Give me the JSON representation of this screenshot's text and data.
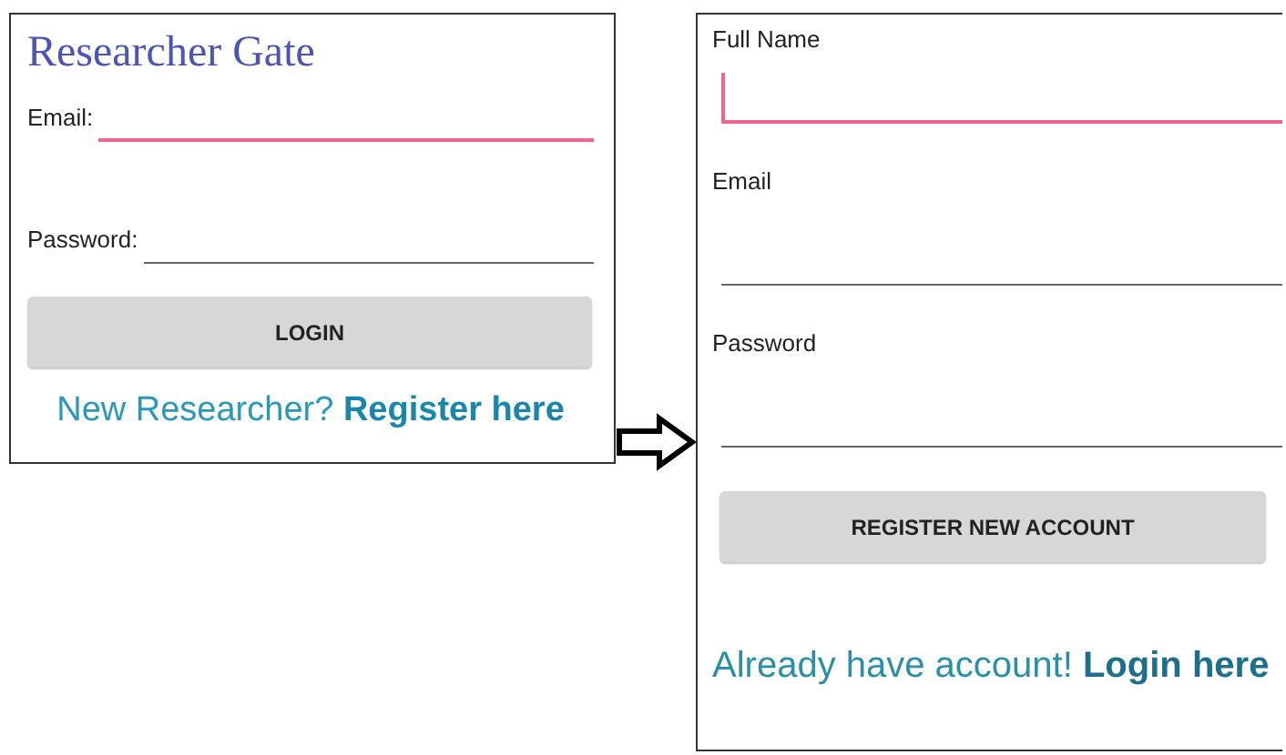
{
  "login_screen": {
    "title": "Researcher Gate",
    "fields": [
      {
        "label": "Email:",
        "focused": true,
        "cursor": false
      },
      {
        "label": "Password:",
        "focused": false,
        "cursor": false
      }
    ],
    "button": "LOGIN",
    "footer": {
      "prompt": "New Researcher?",
      "link": "Register here"
    }
  },
  "register_screen": {
    "fields": [
      {
        "label": "Full Name",
        "focused": true,
        "cursor": true
      },
      {
        "label": "Email",
        "focused": false,
        "cursor": false
      },
      {
        "label": "Password",
        "focused": false,
        "cursor": false
      }
    ],
    "button": "REGISTER NEW ACCOUNT",
    "footer": {
      "prompt": "Already have account!",
      "link": "Login here"
    }
  }
}
